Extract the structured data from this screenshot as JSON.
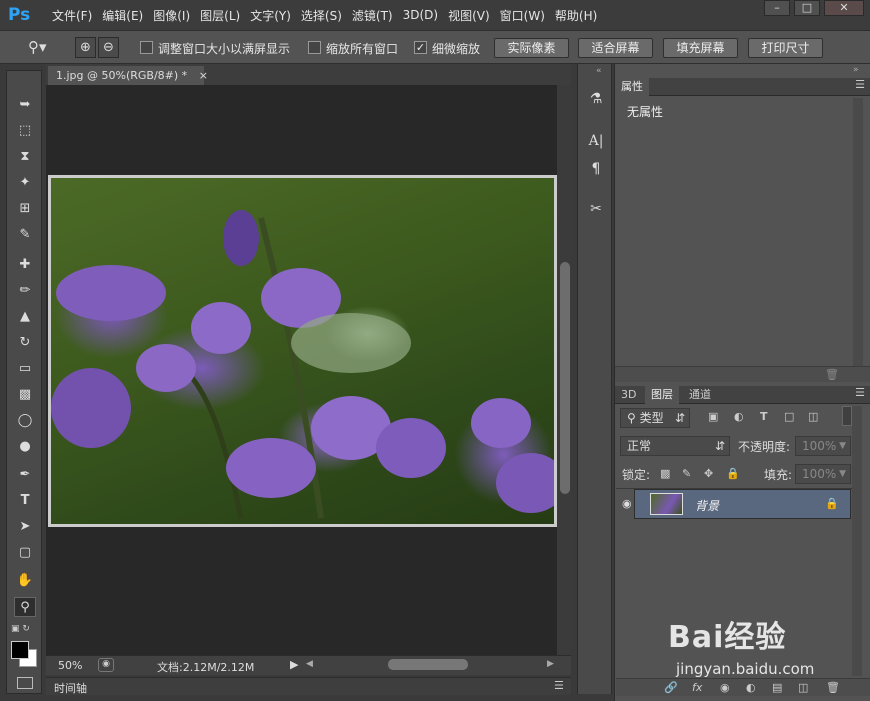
{
  "app": {
    "logo": "Ps"
  },
  "menu": [
    "文件(F)",
    "编辑(E)",
    "图像(I)",
    "图层(L)",
    "文字(Y)",
    "选择(S)",
    "滤镜(T)",
    "3D(D)",
    "视图(V)",
    "窗口(W)",
    "帮助(H)"
  ],
  "window_buttons": {
    "minimize": "–",
    "maximize": "□",
    "close": "✕"
  },
  "options": {
    "resize_windows": "调整窗口大小以满屏显示",
    "zoom_all": "缩放所有窗口",
    "scrubby_zoom": "细微缩放",
    "scrubby_checked": true,
    "btn_actual": "实际像素",
    "btn_fit": "适合屏幕",
    "btn_fill": "填充屏幕",
    "btn_print": "打印尺寸"
  },
  "document": {
    "tab_title": "1.jpg @ 50%(RGB/8#) *",
    "tab_close": "×",
    "zoom": "50%",
    "doc_info": "文档:2.12M/2.12M",
    "timeline": "时间轴"
  },
  "properties": {
    "tab": "属性",
    "content": "无属性"
  },
  "layers": {
    "tabs": [
      "3D",
      "图层",
      "通道"
    ],
    "filter_kind": "类型",
    "blend_mode": "正常",
    "opacity_label": "不透明度:",
    "opacity_value": "100%",
    "lock_label": "锁定:",
    "fill_label": "填充:",
    "fill_value": "100%",
    "layer_name": "背景"
  },
  "watermark": {
    "brand": "Bai经验",
    "url": "jingyan.baidu.com"
  }
}
